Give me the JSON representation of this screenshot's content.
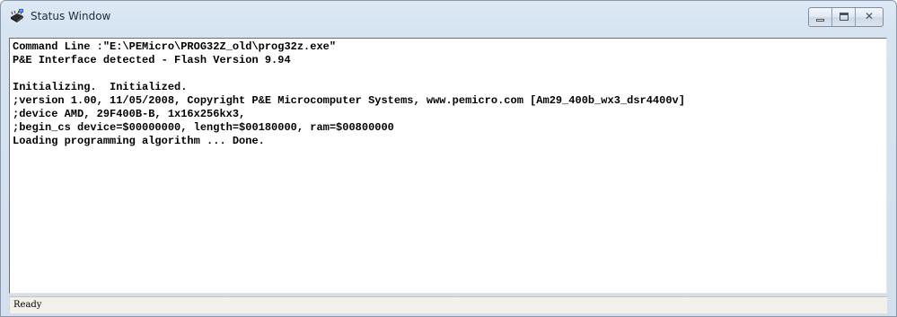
{
  "window": {
    "title": "Status Window",
    "close_glyph": "✕",
    "icon": "processor-chip-icon"
  },
  "log": {
    "lines": [
      "Command Line :\"E:\\PEMicro\\PROG32Z_old\\prog32z.exe\"",
      "P&E Interface detected - Flash Version 9.94",
      "",
      "Initializing.  Initialized.",
      ";version 1.00, 11/05/2008, Copyright P&E Microcomputer Systems, www.pemicro.com [Am29_400b_wx3_dsr4400v]",
      ";device AMD, 29F400B-B, 1x16x256kx3,",
      ";begin_cs device=$00000000, length=$00180000, ram=$00800000",
      "Loading programming algorithm ... Done."
    ]
  },
  "statusbar": {
    "text": "Ready"
  }
}
